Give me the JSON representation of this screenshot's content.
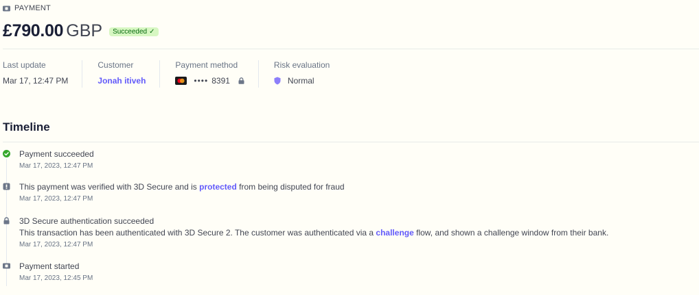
{
  "payment": {
    "type_label": "PAYMENT",
    "amount": "£790.00",
    "currency": "GBP",
    "status_badge": "Succeeded",
    "status_check": "✓"
  },
  "summary": {
    "last_update": {
      "label": "Last update",
      "value": "Mar 17, 12:47 PM"
    },
    "customer": {
      "label": "Customer",
      "value": "Jonah itiveh"
    },
    "payment_method": {
      "label": "Payment method",
      "dots": "••••",
      "last4": "8391"
    },
    "risk": {
      "label": "Risk evaluation",
      "value": "Normal"
    }
  },
  "timeline": {
    "title": "Timeline",
    "events": [
      {
        "title": "Payment succeeded",
        "time": "Mar 17, 2023, 12:47 PM",
        "icon": "check-circle-icon"
      },
      {
        "title_pre": "This payment was verified with 3D Secure and is ",
        "title_link": "protected",
        "title_post": " from being disputed for fraud",
        "time": "Mar 17, 2023, 12:47 PM",
        "icon": "shield-icon"
      },
      {
        "title": "3D Secure authentication succeeded",
        "desc_pre": "This transaction has been authenticated with 3D Secure 2. The customer was authenticated via a ",
        "desc_link": "challenge",
        "desc_post": " flow, and shown a challenge window from their bank.",
        "time": "Mar 17, 2023, 12:47 PM",
        "icon": "lock-icon"
      },
      {
        "title": "Payment started",
        "time": "Mar 17, 2023, 12:45 PM",
        "icon": "payment-icon"
      }
    ]
  },
  "colors": {
    "accent": "#625afa",
    "success": "#36a82c",
    "badge_bg": "#d7f7c2",
    "icon_gray": "#6c7688"
  }
}
